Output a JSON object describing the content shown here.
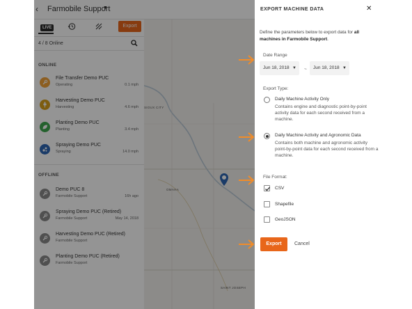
{
  "colors": {
    "accent": "#e8661a",
    "operating": "#f2a33a",
    "harvesting": "#d7a11e",
    "planting": "#3fa84f",
    "spraying": "#2d66b3",
    "offline": "#8a8a8a"
  },
  "topbar": {
    "back_icon": "chevron-left-icon",
    "title": "Farmobile Support",
    "dropdown_icon": "caret-down-icon"
  },
  "panel": {
    "live_tab": "LIVE",
    "export_label": "Export",
    "online_count": "4 / 8 Online",
    "online_header": "ONLINE",
    "offline_header": "OFFLINE",
    "online": [
      {
        "name": "File Transfer Demo PUC",
        "status": "Operating",
        "speed": "0.1 mph"
      },
      {
        "name": "Harvesting Demo PUC",
        "status": "Harvesting",
        "speed": "4.6 mph"
      },
      {
        "name": "Planting Demo PUC",
        "status": "Planting",
        "speed": "3.4 mph"
      },
      {
        "name": "Spraying Demo PUC",
        "status": "Spraying",
        "speed": "14.0 mph"
      }
    ],
    "offline": [
      {
        "name": "Demo PUC 8",
        "status": "Farmobile Support",
        "time": "16h ago"
      },
      {
        "name": "Spraying Demo PUC (Retired)",
        "status": "Farmobile Support",
        "time": "May 14, 2018"
      },
      {
        "name": "Harvesting Demo PUC (Retired)",
        "status": "Farmobile Support",
        "time": ""
      },
      {
        "name": "Planting Demo PUC (Retired)",
        "status": "Farmobile Support",
        "time": ""
      }
    ]
  },
  "map": {
    "labels": [
      "SIOUX CITY",
      "OMAHA",
      "SAINT JOSEPH"
    ]
  },
  "modal": {
    "title": "EXPORT MACHINE DATA",
    "close_icon": "close-icon",
    "desc_pre": "Define the parameters below to export data for ",
    "desc_bold": "all machines in Farmobile Support",
    "desc_post": ".",
    "date_range_label": "Date Range",
    "date_start": "Jun 18, 2018",
    "date_separator": "~",
    "date_end": "Jun 18, 2018",
    "export_type_label": "Export Type:",
    "options": [
      {
        "title": "Daily Machine Activity Only",
        "desc": "Contains engine and diagnostic point-by-point activity data for each second received from a machine.",
        "selected": false
      },
      {
        "title": "Daily Machine Activity and Agronomic Data",
        "desc": "Contains both machine and agronomic activity point-by-point data for each second received from a machine.",
        "selected": true
      }
    ],
    "file_format_label": "File Format:",
    "formats": [
      {
        "label": "CSV",
        "checked": true
      },
      {
        "label": "Shapefile",
        "checked": false
      },
      {
        "label": "GeoJSON",
        "checked": false
      }
    ],
    "export_label": "Export",
    "cancel_label": "Cancel"
  }
}
